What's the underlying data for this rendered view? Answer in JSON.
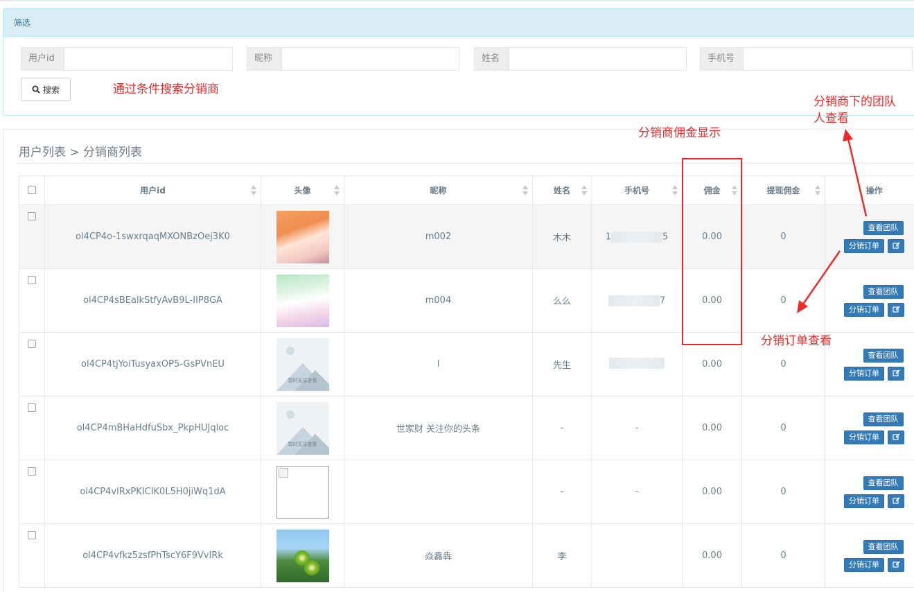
{
  "filter": {
    "heading": "筛选",
    "fields": [
      {
        "label": "用户id",
        "value": "",
        "placeholder": ""
      },
      {
        "label": "昵称",
        "value": "",
        "placeholder": ""
      },
      {
        "label": "姓名",
        "value": "",
        "placeholder": ""
      },
      {
        "label": "手机号",
        "value": "",
        "placeholder": ""
      }
    ],
    "search_label": "搜索",
    "search_icon": "search-icon"
  },
  "list": {
    "breadcrumb": "用户列表 > 分销商列表",
    "columns": [
      "用户id",
      "头像",
      "昵称",
      "姓名",
      "手机号",
      "佣金",
      "提现佣金",
      "操作"
    ],
    "rows": [
      {
        "user_id": "ol4CP4o-1swxrqaqMXONBzOej3K0",
        "avatar": "anime-avatar-1",
        "nickname": "m002",
        "name": "木木",
        "phone_prefix": "1",
        "phone_suffix": "5",
        "commission": "0.00",
        "withdrawn": "0"
      },
      {
        "user_id": "ol4CP4sBEalkStfyAvB9L-IIP8GA",
        "avatar": "anime-avatar-2",
        "nickname": "m004",
        "name": "么么",
        "phone_prefix": "",
        "phone_suffix": "7",
        "commission": "0.00",
        "withdrawn": "0"
      },
      {
        "user_id": "ol4CP4tjYoiTusyaxOP5-GsPVnEU",
        "avatar": "image-unavailable",
        "nickname": "l",
        "name": "先生",
        "phone_prefix": "",
        "phone_suffix": "",
        "commission": "0.00",
        "withdrawn": "0"
      },
      {
        "user_id": "ol4CP4mBHaHdfuSbx_PkpHUJqloc",
        "avatar": "image-unavailable",
        "nickname": "世家财 关注你的头条",
        "name": "-",
        "phone": "-",
        "commission": "0.00",
        "withdrawn": "0"
      },
      {
        "user_id": "ol4CP4vlRxPKICIK0L5H0jiWq1dA",
        "avatar": "broken-image",
        "nickname": "",
        "name": "-",
        "phone": "-",
        "commission": "0.00",
        "withdrawn": "0"
      },
      {
        "user_id": "ol4CP4vfkz5zsfPhTscY6F9VvlRk",
        "avatar": "kiwi-photo",
        "nickname": "焱馫犇",
        "name": "李",
        "phone_prefix": "",
        "phone_suffix": "",
        "commission": "0.00",
        "withdrawn": "0"
      }
    ],
    "unavailable_caption": "暂时无法查看",
    "actions": {
      "view_team": "查看团队",
      "distribution_orders": "分销订单",
      "edit_icon": "edit-icon"
    }
  },
  "annotations": {
    "search_note": "通过条件搜索分销商",
    "commission_note": "分销商佣金显示",
    "team_note_line1": "分销商下的团队",
    "team_note_line2": "人查看",
    "order_note": "分销订单查看",
    "color": "#ef2a2a"
  },
  "colors": {
    "primary_button": "#337ab7",
    "filter_heading_bg": "#d9edf7"
  }
}
